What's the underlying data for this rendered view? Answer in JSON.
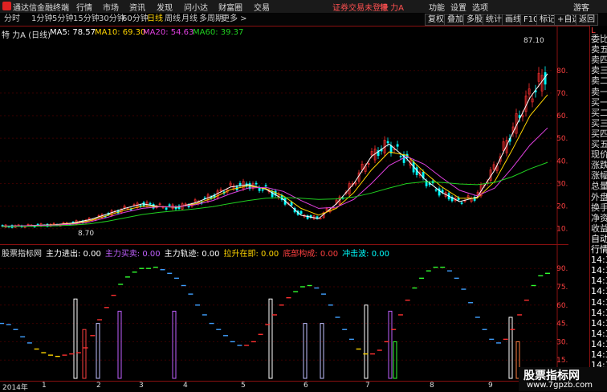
{
  "menubar": {
    "app_title": "通达信金融终端",
    "menus": [
      "行情",
      "市场",
      "资讯",
      "发现",
      "问小达",
      "财富圈",
      "交易"
    ],
    "login_status": "证券交易未登录",
    "stock_name": "特 力A",
    "right_items": [
      "功能",
      "设置",
      "选项",
      "游客"
    ]
  },
  "toolbar": {
    "periods": [
      "分时",
      "1分钟",
      "5分钟",
      "15分钟",
      "30分钟",
      "60分钟",
      "日线",
      "周线",
      "月线",
      "多周期",
      "更多 >"
    ],
    "active_period": "日线",
    "right_buttons": [
      "复权",
      "叠加",
      "多股",
      "统计",
      "画线",
      "F10",
      "标记",
      "+自选",
      "返回"
    ]
  },
  "chart_header": {
    "title": "特 力A (日线)",
    "ma5_label": "MA5: 78.57",
    "ma10_label": "MA10: 69.30",
    "ma20_label": "MA20: 54.63",
    "ma60_label": "MA60: 39.37",
    "colors": {
      "ma5": "#ffffff",
      "ma10": "#ffd400",
      "ma20": "#e040e0",
      "ma60": "#20d020"
    }
  },
  "price_axis": {
    "ticks": [
      "80.00",
      "70.00",
      "60.00",
      "50.00",
      "40.00",
      "30.00",
      "20.00",
      "10.00"
    ],
    "high_label": "87.10",
    "low_label": "8.70"
  },
  "indicator_header": {
    "name": "股票指标网",
    "items": [
      {
        "label": "主力进出: 0.00",
        "color": "#ffffff"
      },
      {
        "label": "主力买卖: 0.00",
        "color": "#c060ff"
      },
      {
        "label": "主力轨迹: 0.00",
        "color": "#ffffff"
      },
      {
        "label": "拉升在即: 0.00",
        "color": "#ffd400"
      },
      {
        "label": "底部构成: 0.00",
        "color": "#ff4040"
      },
      {
        "label": "冲击波: 0.00",
        "color": "#00ffff"
      }
    ]
  },
  "indicator_axis": {
    "ticks": [
      "90.00",
      "75.00",
      "60.00",
      "45.00",
      "30.00",
      "15.00"
    ]
  },
  "time_axis": {
    "labels": [
      "2014年",
      "1",
      "2",
      "3",
      "4",
      "5",
      "6",
      "7",
      "8",
      "9",
      "1"
    ]
  },
  "side_panel": {
    "top_code": "L",
    "items": [
      "委比",
      "卖五",
      "卖四",
      "卖三",
      "卖二",
      "卖一",
      "买一",
      "买二",
      "买三",
      "买四",
      "买五",
      "现价",
      "涨跌",
      "涨幅",
      "总量",
      "外盘",
      "换手",
      "净资",
      "收益",
      "自动",
      "行情",
      "14:34",
      "14:35",
      "14:35",
      "14:35",
      "14:35",
      "14:35",
      "14:35",
      "14:35",
      "14:35",
      "14:35",
      "14:35",
      "14:35"
    ]
  },
  "watermark": {
    "line1": "股票指标网",
    "line2": "www.7gpzb.com"
  },
  "chart_data": {
    "type": "line",
    "title": "特 力A (日线)",
    "price_ylim": [
      6,
      92
    ],
    "series": [
      {
        "name": "MA5",
        "values": [
          11.0,
          11.2,
          11.5,
          11.8,
          12.5,
          14.0,
          16.5,
          19.0,
          21.0,
          19.8,
          19.5,
          21.5,
          24.5,
          28.5,
          29.5,
          27.5,
          23.0,
          16.0,
          14.5,
          21.0,
          30.0,
          42.0,
          47.5,
          41.0,
          32.0,
          26.0,
          22.0,
          24.0,
          36.0,
          52.0,
          68.0,
          78.57
        ]
      },
      {
        "name": "MA10",
        "values": [
          11.1,
          11.2,
          11.4,
          11.7,
          12.2,
          13.5,
          15.8,
          18.2,
          20.0,
          19.8,
          19.6,
          21.0,
          23.6,
          27.3,
          29.0,
          27.8,
          24.5,
          19.0,
          16.0,
          19.0,
          26.0,
          36.0,
          44.0,
          42.5,
          35.0,
          28.5,
          23.5,
          23.5,
          31.0,
          45.0,
          60.0,
          69.3
        ]
      },
      {
        "name": "MA20",
        "values": [
          11.2,
          11.3,
          11.4,
          11.6,
          12.0,
          13.0,
          15.0,
          17.3,
          19.0,
          19.7,
          19.8,
          20.6,
          22.5,
          25.5,
          28.0,
          28.3,
          26.5,
          22.5,
          19.0,
          19.5,
          23.0,
          30.0,
          38.0,
          42.0,
          38.5,
          32.5,
          27.0,
          24.5,
          28.0,
          37.0,
          47.0,
          54.63
        ]
      },
      {
        "name": "MA60",
        "values": [
          11.0,
          11.0,
          11.1,
          11.3,
          11.6,
          12.2,
          13.3,
          14.8,
          16.3,
          17.3,
          18.0,
          18.8,
          19.8,
          21.2,
          22.5,
          23.5,
          23.8,
          23.5,
          23.0,
          23.2,
          24.0,
          25.8,
          28.0,
          30.0,
          30.8,
          30.5,
          29.8,
          29.5,
          30.5,
          33.0,
          36.5,
          39.37
        ]
      }
    ],
    "indicator": {
      "ylim": [
        0,
        100
      ],
      "trail": [
        45,
        44,
        40,
        34,
        29,
        24,
        21,
        19,
        18,
        19,
        20,
        21,
        25,
        35,
        48,
        58,
        68,
        77,
        83,
        87,
        90,
        90,
        91,
        89,
        86,
        82,
        76,
        69,
        60,
        52,
        45,
        40,
        35,
        30,
        27,
        27,
        30,
        36,
        44,
        52,
        60,
        66,
        71,
        75,
        76,
        74,
        69,
        60,
        50,
        40,
        32,
        24,
        20,
        20,
        23,
        30,
        40,
        52,
        64,
        74,
        82,
        88,
        91,
        91,
        88,
        82,
        73,
        62,
        50,
        40,
        32,
        29,
        32,
        40,
        52,
        64,
        76,
        84,
        86
      ]
    }
  }
}
